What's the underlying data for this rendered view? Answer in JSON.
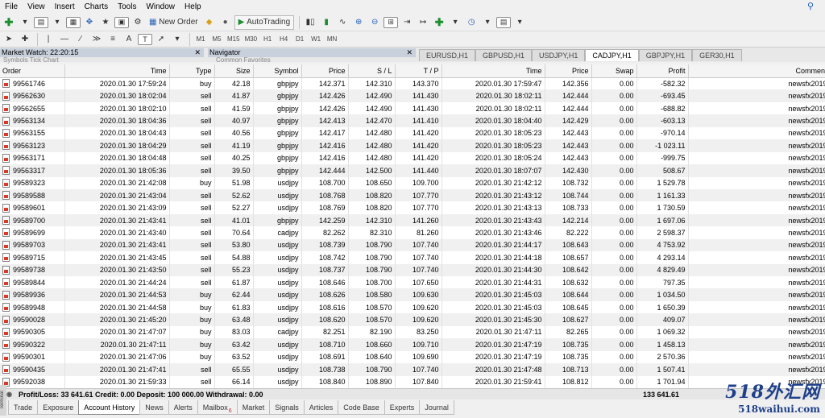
{
  "menu": [
    "File",
    "View",
    "Insert",
    "Charts",
    "Tools",
    "Window",
    "Help"
  ],
  "toolbar": {
    "new_order": "New Order",
    "autotrading": "AutoTrading",
    "timeframes": [
      "M1",
      "M5",
      "M15",
      "M30",
      "H1",
      "H4",
      "D1",
      "W1",
      "MN"
    ],
    "text_tool": "A"
  },
  "panels": {
    "market_watch": "Market Watch: 22:20:15",
    "market_watch_tabs": "Symbols   Tick Chart",
    "navigator": "Navigator",
    "navigator_tabs": "Common   Favorites"
  },
  "chart_tabs": [
    "EURUSD,H1",
    "GBPUSD,H1",
    "USDJPY,H1",
    "CADJPY,H1",
    "GBPJPY,H1",
    "GER30,H1"
  ],
  "active_chart_tab": "CADJPY,H1",
  "columns": [
    "Order",
    "Time",
    "Type",
    "Size",
    "Symbol",
    "Price",
    "S / L",
    "T / P",
    "Time",
    "Price",
    "Swap",
    "Profit",
    "Comment"
  ],
  "rows": [
    [
      "99561746",
      "2020.01.30 17:59:24",
      "buy",
      "42.18",
      "gbpjpy",
      "142.371",
      "142.310",
      "143.370",
      "2020.01.30 17:59:47",
      "142.356",
      "0.00",
      "-582.32",
      "newsfx2019"
    ],
    [
      "99562630",
      "2020.01.30 18:02:04",
      "sell",
      "41.87",
      "gbpjpy",
      "142.426",
      "142.490",
      "141.430",
      "2020.01.30 18:02:11",
      "142.444",
      "0.00",
      "-693.45",
      "newsfx2019"
    ],
    [
      "99562655",
      "2020.01.30 18:02:10",
      "sell",
      "41.59",
      "gbpjpy",
      "142.426",
      "142.490",
      "141.430",
      "2020.01.30 18:02:11",
      "142.444",
      "0.00",
      "-688.82",
      "newsfx2019"
    ],
    [
      "99563134",
      "2020.01.30 18:04:36",
      "sell",
      "40.97",
      "gbpjpy",
      "142.413",
      "142.470",
      "141.410",
      "2020.01.30 18:04:40",
      "142.429",
      "0.00",
      "-603.13",
      "newsfx2019"
    ],
    [
      "99563155",
      "2020.01.30 18:04:43",
      "sell",
      "40.56",
      "gbpjpy",
      "142.417",
      "142.480",
      "141.420",
      "2020.01.30 18:05:23",
      "142.443",
      "0.00",
      "-970.14",
      "newsfx2019"
    ],
    [
      "99563123",
      "2020.01.30 18:04:29",
      "sell",
      "41.19",
      "gbpjpy",
      "142.416",
      "142.480",
      "141.420",
      "2020.01.30 18:05:23",
      "142.443",
      "0.00",
      "-1 023.11",
      "newsfx2019"
    ],
    [
      "99563171",
      "2020.01.30 18:04:48",
      "sell",
      "40.25",
      "gbpjpy",
      "142.416",
      "142.480",
      "141.420",
      "2020.01.30 18:05:24",
      "142.443",
      "0.00",
      "-999.75",
      "newsfx2019"
    ],
    [
      "99563317",
      "2020.01.30 18:05:36",
      "sell",
      "39.50",
      "gbpjpy",
      "142.444",
      "142.500",
      "141.440",
      "2020.01.30 18:07:07",
      "142.430",
      "0.00",
      "508.67",
      "newsfx2019"
    ],
    [
      "99589323",
      "2020.01.30 21:42:08",
      "buy",
      "51.98",
      "usdjpy",
      "108.700",
      "108.650",
      "109.700",
      "2020.01.30 21:42:12",
      "108.732",
      "0.00",
      "1 529.78",
      "newsfx2019"
    ],
    [
      "99589588",
      "2020.01.30 21:43:04",
      "sell",
      "52.62",
      "usdjpy",
      "108.768",
      "108.820",
      "107.770",
      "2020.01.30 21:43:12",
      "108.744",
      "0.00",
      "1 161.33",
      "newsfx2019"
    ],
    [
      "99589601",
      "2020.01.30 21:43:09",
      "sell",
      "52.27",
      "usdjpy",
      "108.769",
      "108.820",
      "107.770",
      "2020.01.30 21:43:13",
      "108.733",
      "0.00",
      "1 730.59",
      "newsfx2019"
    ],
    [
      "99589700",
      "2020.01.30 21:43:41",
      "sell",
      "41.01",
      "gbpjpy",
      "142.259",
      "142.310",
      "141.260",
      "2020.01.30 21:43:43",
      "142.214",
      "0.00",
      "1 697.06",
      "newsfx2019"
    ],
    [
      "99589699",
      "2020.01.30 21:43:40",
      "sell",
      "70.64",
      "cadjpy",
      "82.262",
      "82.310",
      "81.260",
      "2020.01.30 21:43:46",
      "82.222",
      "0.00",
      "2 598.37",
      "newsfx2019"
    ],
    [
      "99589703",
      "2020.01.30 21:43:41",
      "sell",
      "53.80",
      "usdjpy",
      "108.739",
      "108.790",
      "107.740",
      "2020.01.30 21:44:17",
      "108.643",
      "0.00",
      "4 753.92",
      "newsfx2019"
    ],
    [
      "99589715",
      "2020.01.30 21:43:45",
      "sell",
      "54.88",
      "usdjpy",
      "108.742",
      "108.790",
      "107.740",
      "2020.01.30 21:44:18",
      "108.657",
      "0.00",
      "4 293.14",
      "newsfx2019"
    ],
    [
      "99589738",
      "2020.01.30 21:43:50",
      "sell",
      "55.23",
      "usdjpy",
      "108.737",
      "108.790",
      "107.740",
      "2020.01.30 21:44:30",
      "108.642",
      "0.00",
      "4 829.49",
      "newsfx2019"
    ],
    [
      "99589844",
      "2020.01.30 21:44:24",
      "sell",
      "61.87",
      "usdjpy",
      "108.646",
      "108.700",
      "107.650",
      "2020.01.30 21:44:31",
      "108.632",
      "0.00",
      "797.35",
      "newsfx2019"
    ],
    [
      "99589936",
      "2020.01.30 21:44:53",
      "buy",
      "62.44",
      "usdjpy",
      "108.626",
      "108.580",
      "109.630",
      "2020.01.30 21:45:03",
      "108.644",
      "0.00",
      "1 034.50",
      "newsfx2019"
    ],
    [
      "99589948",
      "2020.01.30 21:44:58",
      "buy",
      "61.83",
      "usdjpy",
      "108.616",
      "108.570",
      "109.620",
      "2020.01.30 21:45:03",
      "108.645",
      "0.00",
      "1 650.39",
      "newsfx2019"
    ],
    [
      "99590028",
      "2020.01.30 21:45:20",
      "buy",
      "63.48",
      "usdjpy",
      "108.620",
      "108.570",
      "109.620",
      "2020.01.30 21:45:30",
      "108.627",
      "0.00",
      "409.07",
      "newsfx2019"
    ],
    [
      "99590305",
      "2020.01.30 21:47:07",
      "buy",
      "83.03",
      "cadjpy",
      "82.251",
      "82.190",
      "83.250",
      "2020.01.30 21:47:11",
      "82.265",
      "0.00",
      "1 069.32",
      "newsfx2019"
    ],
    [
      "99590322",
      "2020.01.30 21:47:11",
      "buy",
      "63.42",
      "usdjpy",
      "108.710",
      "108.660",
      "109.710",
      "2020.01.30 21:47:19",
      "108.735",
      "0.00",
      "1 458.13",
      "newsfx2019"
    ],
    [
      "99590301",
      "2020.01.30 21:47:06",
      "buy",
      "63.52",
      "usdjpy",
      "108.691",
      "108.640",
      "109.690",
      "2020.01.30 21:47:19",
      "108.735",
      "0.00",
      "2 570.36",
      "newsfx2019"
    ],
    [
      "99590435",
      "2020.01.30 21:47:41",
      "sell",
      "65.55",
      "usdjpy",
      "108.738",
      "108.790",
      "107.740",
      "2020.01.30 21:47:48",
      "108.713",
      "0.00",
      "1 507.41",
      "newsfx2019"
    ],
    [
      "99592038",
      "2020.01.30 21:59:33",
      "sell",
      "66.14",
      "usdjpy",
      "108.840",
      "108.890",
      "107.840",
      "2020.01.30 21:59:41",
      "108.812",
      "0.00",
      "1 701.94",
      "newsfx2019"
    ]
  ],
  "summary": {
    "text": "Profit/Loss: 33 641.61  Credit: 0.00  Deposit: 100 000.00  Withdrawal: 0.00",
    "total": "133 641.61"
  },
  "terminal_label": "Terminal",
  "bottom_tabs": [
    "Trade",
    "Exposure",
    "Account History",
    "News",
    "Alerts",
    "Mailbox",
    "Market",
    "Signals",
    "Articles",
    "Code Base",
    "Experts",
    "Journal"
  ],
  "active_bottom_tab": "Account History",
  "mailbox_badge": "6",
  "watermark": {
    "line1": "518外汇网",
    "line2": "518waihui.com"
  }
}
